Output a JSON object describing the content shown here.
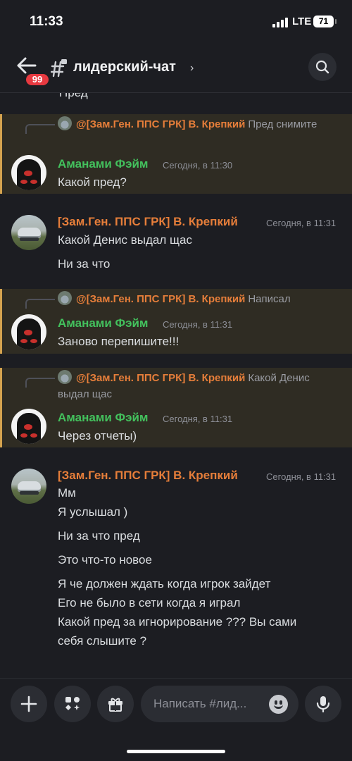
{
  "status_bar": {
    "time": "11:33",
    "network": "LTE",
    "battery": "71"
  },
  "header": {
    "back_icon": "arrow-left-icon",
    "unread_badge": "99",
    "channel_icon": "hash-lock-icon",
    "channel_name": "лидерский-чат",
    "chevron": "›",
    "search_icon": "search-icon"
  },
  "messages": {
    "cut_off_text": "Пред",
    "group1": {
      "reply_author": "@[Зам.Ген. ППС ГРК] В. Крепкий",
      "reply_text": "Пред снимите",
      "author": "Аманами Фэйм",
      "timestamp": "Сегодня, в 11:30",
      "lines": [
        "Какой пред?"
      ]
    },
    "group2": {
      "author": "[Зам.Ген. ППС ГРК] В. Крепкий",
      "timestamp": "Сегодня, в 11:31",
      "lines": [
        "Какой Денис выдал щас",
        "Ни за что"
      ]
    },
    "group3": {
      "reply_author": "@[Зам.Ген. ППС ГРК] В. Крепкий",
      "reply_text": "Написал",
      "author": "Аманами Фэйм",
      "timestamp": "Сегодня, в 11:31",
      "lines": [
        "Заново перепишите!!!"
      ]
    },
    "group4": {
      "reply_author": "@[Зам.Ген. ППС ГРК] В. Крепкий",
      "reply_text": "Какой Денис выдал щас",
      "author": "Аманами Фэйм",
      "timestamp": "Сегодня, в 11:31",
      "lines": [
        "Через отчеты)"
      ]
    },
    "group5": {
      "author": "[Зам.Ген. ППС ГРК] В. Крепкий",
      "timestamp": "Сегодня, в 11:31",
      "lines": [
        "Мм",
        "Я услышал )",
        "Ни за что пред",
        "Это что-то новое",
        "Я че должен ждать когда игрок зайдет",
        "Его не было в сети когда я играл",
        "Какой пред за игнорирование ??? Вы сами",
        "себя слышите ?"
      ]
    }
  },
  "composer": {
    "placeholder": "Написать #лид...",
    "buttons": [
      "plus-icon",
      "apps-icon",
      "gift-icon",
      "emoji-icon",
      "microphone-icon"
    ]
  },
  "colors": {
    "accent_orange": "#e67e3a",
    "green_name": "#43c15d",
    "highlight_bar": "#d5a34f",
    "badge": "#e73940"
  }
}
